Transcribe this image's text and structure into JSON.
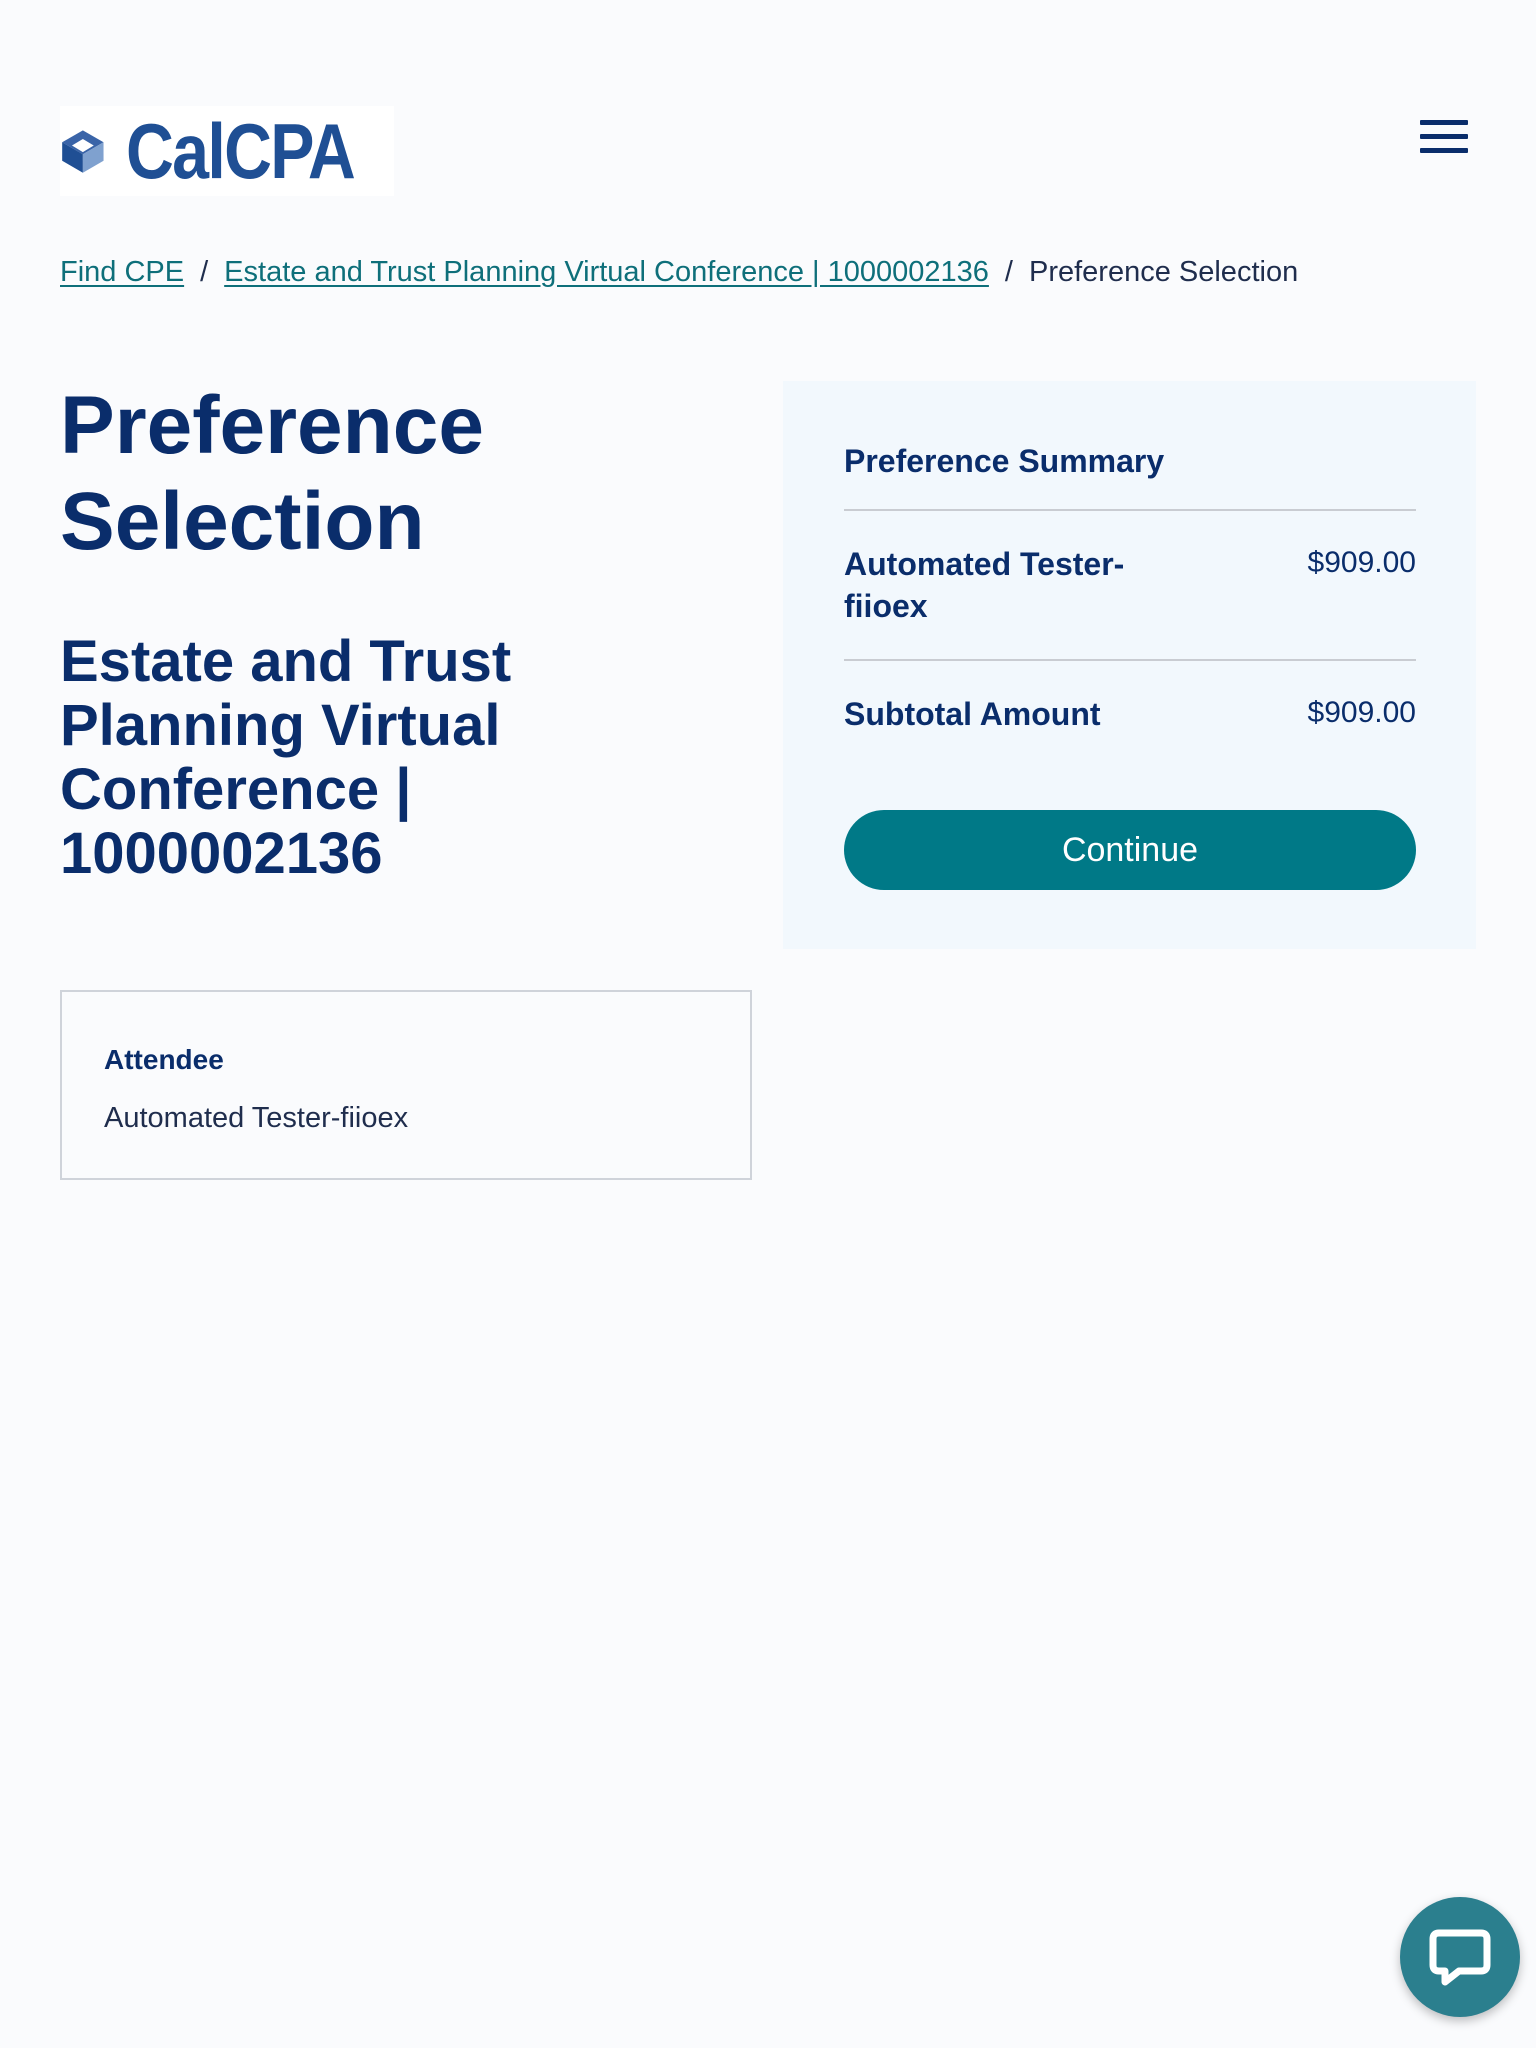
{
  "header": {
    "logo_text": "CalCPA",
    "logo_icon": "calcpa-cube-logo",
    "menu_icon": "hamburger-menu-icon"
  },
  "breadcrumb": {
    "items": [
      {
        "label": "Find CPE"
      },
      {
        "label": "Estate and Trust Planning Virtual Conference | 1000002136"
      }
    ],
    "current": "Preference Selection",
    "separator": "/"
  },
  "main": {
    "title": "Preference Selection",
    "event_title": "Estate and Trust Planning Virtual Conference | 1000002136",
    "attendee": {
      "label": "Attendee",
      "name": "Automated Tester-fiioex"
    }
  },
  "summary": {
    "title": "Preference Summary",
    "line_item": {
      "name": "Automated Tester-fiioex",
      "price": "$909.00"
    },
    "subtotal_label": "Subtotal Amount",
    "subtotal_value": "$909.00",
    "continue_label": "Continue"
  },
  "chat": {
    "icon": "chat-bubble-icon"
  },
  "colors": {
    "navy": "#0a2d6b",
    "teal": "#007987",
    "link": "#0e6f7a",
    "panel": "#f2f8fd",
    "background": "#fafbfd"
  }
}
